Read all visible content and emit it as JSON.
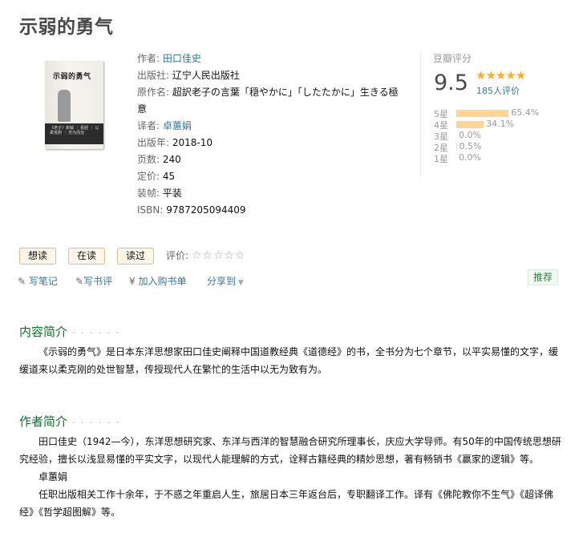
{
  "title": "示弱的勇气",
  "cover": {
    "title": "示弱的勇气",
    "band_text": "《老子》新解 ｜ 看轻 ｜ 以柔克刚 ｜ 无为而治"
  },
  "info": {
    "author_label": "作者:",
    "author": "田口佳史",
    "publisher_label": "出版社:",
    "publisher": "辽宁人民出版社",
    "original_label": "原作名:",
    "original": "超訳老子の言葉「穏やかに」「したたかに」生きる極意",
    "translator_label": "译者:",
    "translator": "卓蕙娟",
    "year_label": "出版年:",
    "year": "2018-10",
    "pages_label": "页数:",
    "pages": "240",
    "price_label": "定价:",
    "price": "45",
    "binding_label": "装帧:",
    "binding": "平装",
    "isbn_label": "ISBN:",
    "isbn": "9787205094409"
  },
  "rating": {
    "label": "豆瓣评分",
    "score": "9.5",
    "stars": "★★★★★",
    "count": "185人评价",
    "bars": [
      {
        "label": "5星",
        "pct": "65.4%",
        "value": 65.4
      },
      {
        "label": "4星",
        "pct": "34.1%",
        "value": 34.1
      },
      {
        "label": "3星",
        "pct": "0.0%",
        "value": 0.0
      },
      {
        "label": "2星",
        "pct": "0.5%",
        "value": 0.5
      },
      {
        "label": "1星",
        "pct": "0.0%",
        "value": 0.0
      }
    ]
  },
  "actions": {
    "want": "想读",
    "reading": "在读",
    "read": "读过",
    "rate_label": "评价:",
    "empty_stars": "☆☆☆☆☆"
  },
  "links": {
    "note": "写笔记",
    "review": "写书评",
    "cart": "加入购书单",
    "share": "分享到",
    "recommend": "推荐"
  },
  "sections": {
    "intro_title": "内容简介",
    "intro_dots": "· · · · · ·",
    "intro_text": "《示弱的勇气》是日本东洋思想家田口佳史阐释中国道教经典《道德经》的书，全书分为七个章节，以平实易懂的文字，缓缓道来以柔克刚的处世智慧，传授现代人在繁忙的生活中以无为致有为。",
    "author_title": "作者简介",
    "author_dots": "· · · · · ·",
    "author_text1": "田口佳史（1942—今），东洋思想研究家、东洋与西洋的智慧融合研究所理事长，庆应大学导师。有50年的中国传统思想研究经验，擅长以浅显易懂的平实文字，以现代人能理解的方式，诠释古籍经典的精妙思想，著有畅销书《赢家的逻辑》等。",
    "author_name2": "卓蕙娟",
    "author_text2": "任职出版相关工作十余年，于不惑之年重启人生，旅居日本三年返台后，专职翻译工作。译有《佛陀教你不生气》《超译佛经》《哲学超图解》等。"
  }
}
